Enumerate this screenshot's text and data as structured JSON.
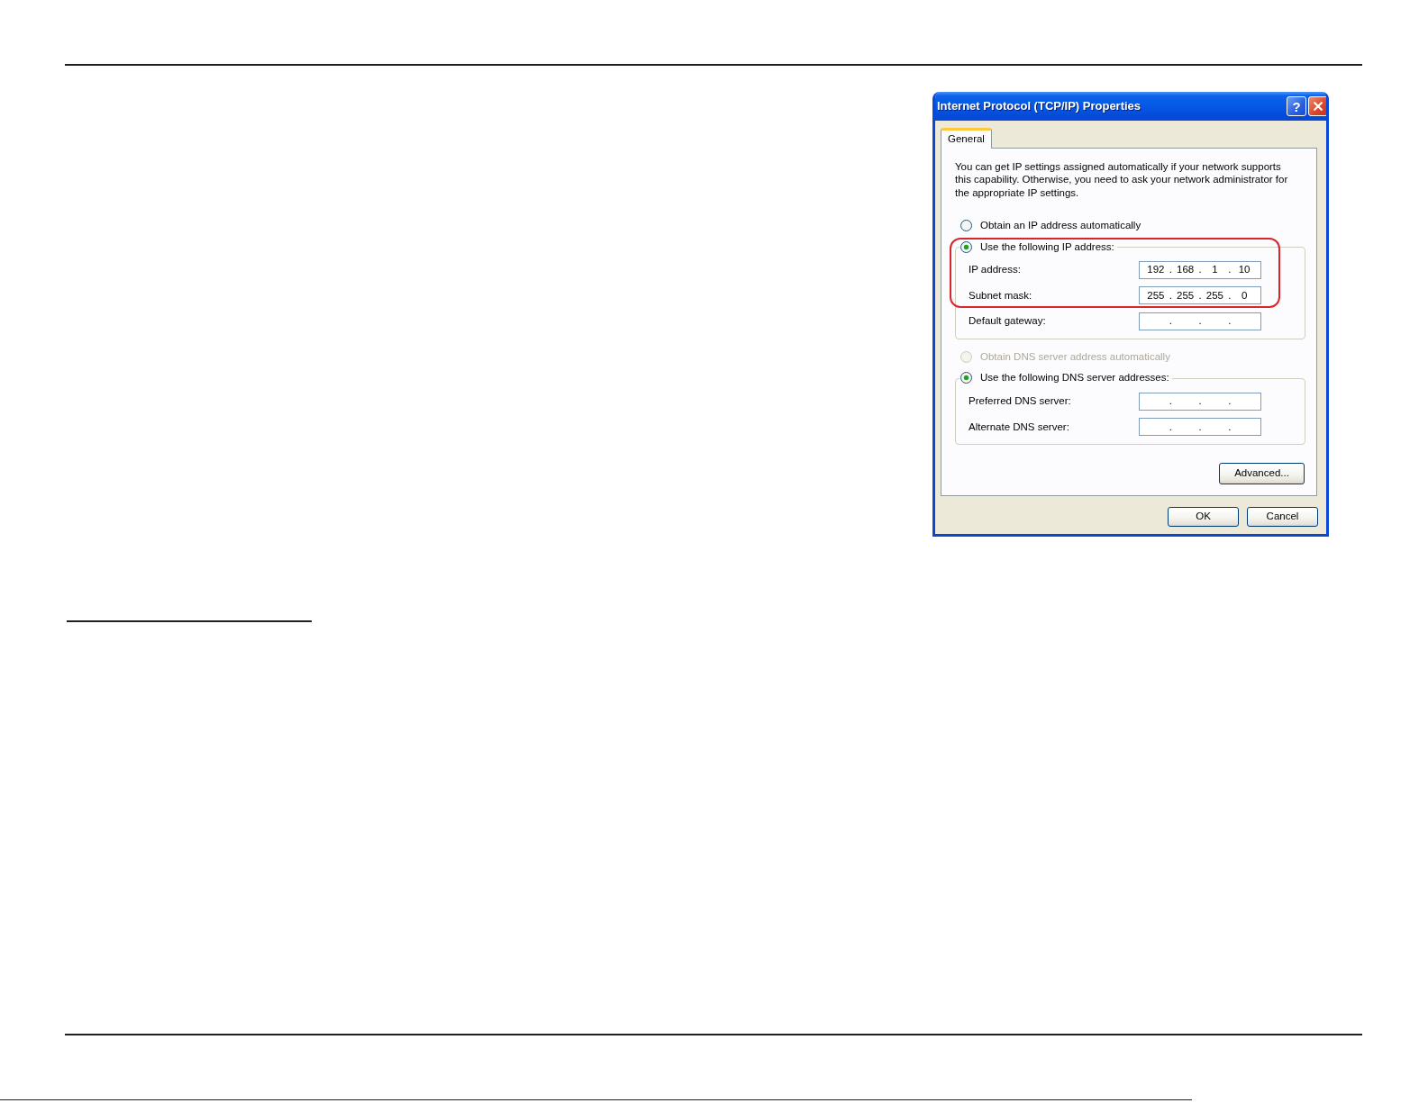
{
  "dialog": {
    "title": "Internet Protocol (TCP/IP) Properties",
    "title_buttons": [
      {
        "kind": "help",
        "label": "?"
      },
      {
        "kind": "close"
      }
    ],
    "tabs": [
      {
        "label": "General",
        "selected": true
      }
    ],
    "description": "You can get IP settings assigned automatically if your network supports this capability. Otherwise, you need to ask your network administrator for the appropriate IP settings.",
    "ip_settings": {
      "options": [
        {
          "label": "Obtain an IP address automatically",
          "selected": false,
          "disabled": false
        }
      ],
      "highlight_outline": {
        "group_option": {
          "label": "Use the following IP address:",
          "selected": true,
          "disabled": false
        },
        "fields": [
          {
            "label": "IP address:",
            "octets": [
              "192",
              "168",
              "1",
              "10"
            ],
            "separators": [
              ".",
              ".",
              "."
            ]
          },
          {
            "label": "Subnet mask:",
            "octets": [
              "255",
              "255",
              "255",
              "0"
            ],
            "separators": [
              ".",
              ".",
              "."
            ]
          }
        ]
      },
      "fields": [
        {
          "label": "Default gateway:",
          "separators": [
            ".",
            ".",
            "."
          ]
        }
      ]
    },
    "dns_settings": {
      "options": [
        {
          "label": "Obtain DNS server address automatically",
          "selected": false,
          "disabled": true
        }
      ],
      "group_option": {
        "label": "Use the following DNS server addresses:",
        "selected": true,
        "disabled": false
      },
      "fields": [
        {
          "label": "Preferred DNS server:",
          "separators": [
            ".",
            ".",
            "."
          ]
        },
        {
          "label": "Alternate DNS server:",
          "separators": [
            ".",
            ".",
            "."
          ]
        }
      ]
    },
    "advanced_button": "Advanced...",
    "buttons": [
      "OK",
      "Cancel"
    ]
  }
}
